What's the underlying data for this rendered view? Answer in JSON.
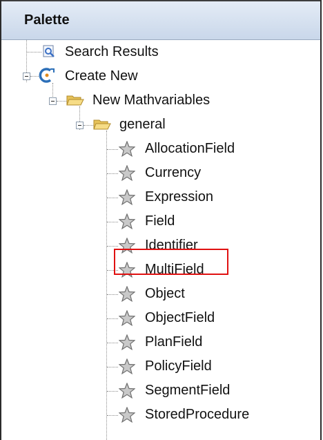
{
  "palette": {
    "title": "Palette",
    "root_items": [
      {
        "label": "Search Results",
        "icon": "search-results-icon"
      },
      {
        "label": "Create New",
        "icon": "create-new-icon"
      }
    ],
    "folders": [
      {
        "label": "New Mathvariables",
        "icon": "folder-icon"
      },
      {
        "label": "general",
        "icon": "folder-icon"
      }
    ],
    "items": [
      {
        "label": "AllocationField",
        "icon": "star-icon"
      },
      {
        "label": "Currency",
        "icon": "star-icon"
      },
      {
        "label": "Expression",
        "icon": "star-icon"
      },
      {
        "label": "Field",
        "icon": "star-icon"
      },
      {
        "label": "Identifier",
        "icon": "star-icon"
      },
      {
        "label": "MultiField",
        "icon": "star-icon",
        "highlighted": true
      },
      {
        "label": "Object",
        "icon": "star-icon"
      },
      {
        "label": "ObjectField",
        "icon": "star-icon"
      },
      {
        "label": "PlanField",
        "icon": "star-icon"
      },
      {
        "label": "PolicyField",
        "icon": "star-icon"
      },
      {
        "label": "SegmentField",
        "icon": "star-icon"
      },
      {
        "label": "StoredProcedure",
        "icon": "star-icon"
      }
    ],
    "highlight_color": "#e01010"
  }
}
